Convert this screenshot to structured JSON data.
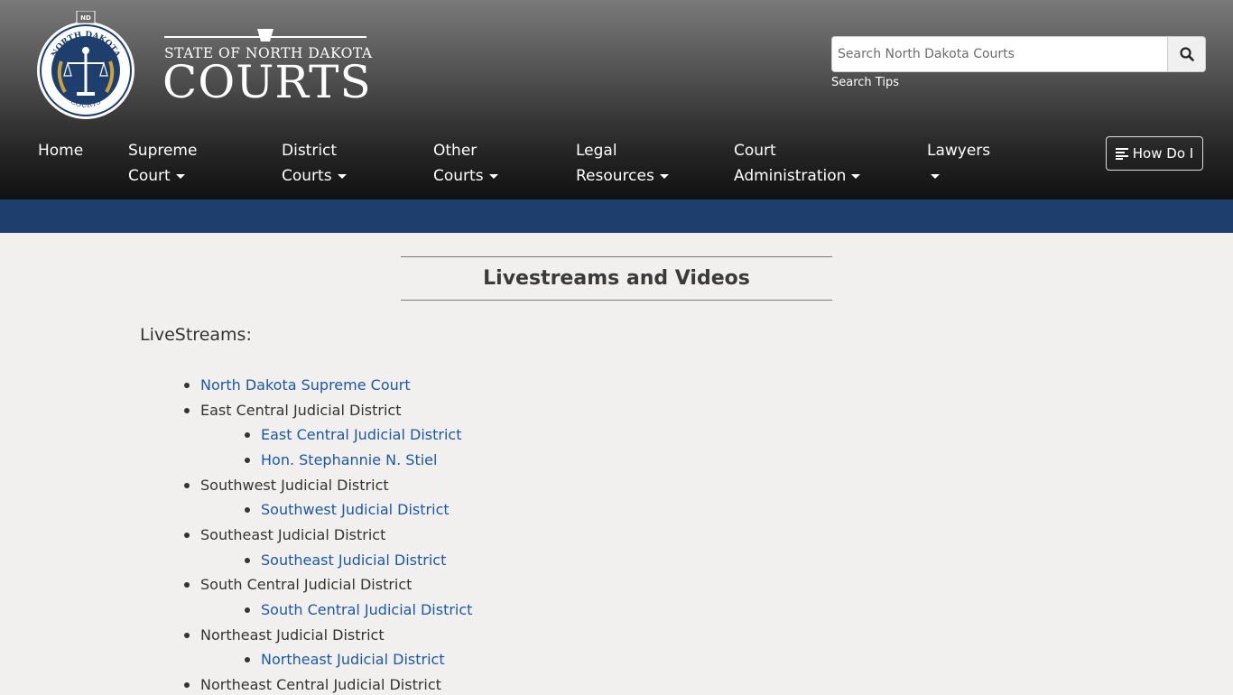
{
  "seal": {
    "arc_text": "NORTH DAKOTA",
    "bottom_text": "COURTS",
    "badge": "ND"
  },
  "logo": {
    "top": "STATE OF NORTH DAKOTA",
    "main": "COURTS"
  },
  "search": {
    "placeholder": "Search North Dakota Courts",
    "tips": "Search Tips"
  },
  "nav": {
    "home": "Home",
    "supreme_1": "Supreme",
    "supreme_2": "Court",
    "district_1": "District",
    "district_2": "Courts",
    "other_1": "Other",
    "other_2": "Courts",
    "legal_1": "Legal",
    "legal_2": "Resources",
    "admin_1": "Court",
    "admin_2": "Administration",
    "lawyers": "Lawyers",
    "howdoi": "How Do I"
  },
  "page": {
    "title": "Livestreams and Videos",
    "section": "LiveStreams:"
  },
  "list": {
    "supreme": "North Dakota Supreme Court",
    "east_central": "East Central Judicial District",
    "east_central_link": "East Central Judicial District",
    "stiel": "Hon. Stephannie N. Stiel",
    "southwest": "Southwest Judicial District",
    "southwest_link": "Southwest Judicial District",
    "southeast": "Southeast Judicial District",
    "southeast_link": "Southeast Judicial District",
    "south_central": "South Central Judicial District",
    "south_central_link": "South Central Judicial District",
    "northeast": "Northeast Judicial District",
    "northeast_link": "Northeast Judicial District",
    "northeast_central": "Northeast Central Judicial District"
  },
  "colors": {
    "link": "#1c58a6",
    "band": "#1e3f6e"
  }
}
